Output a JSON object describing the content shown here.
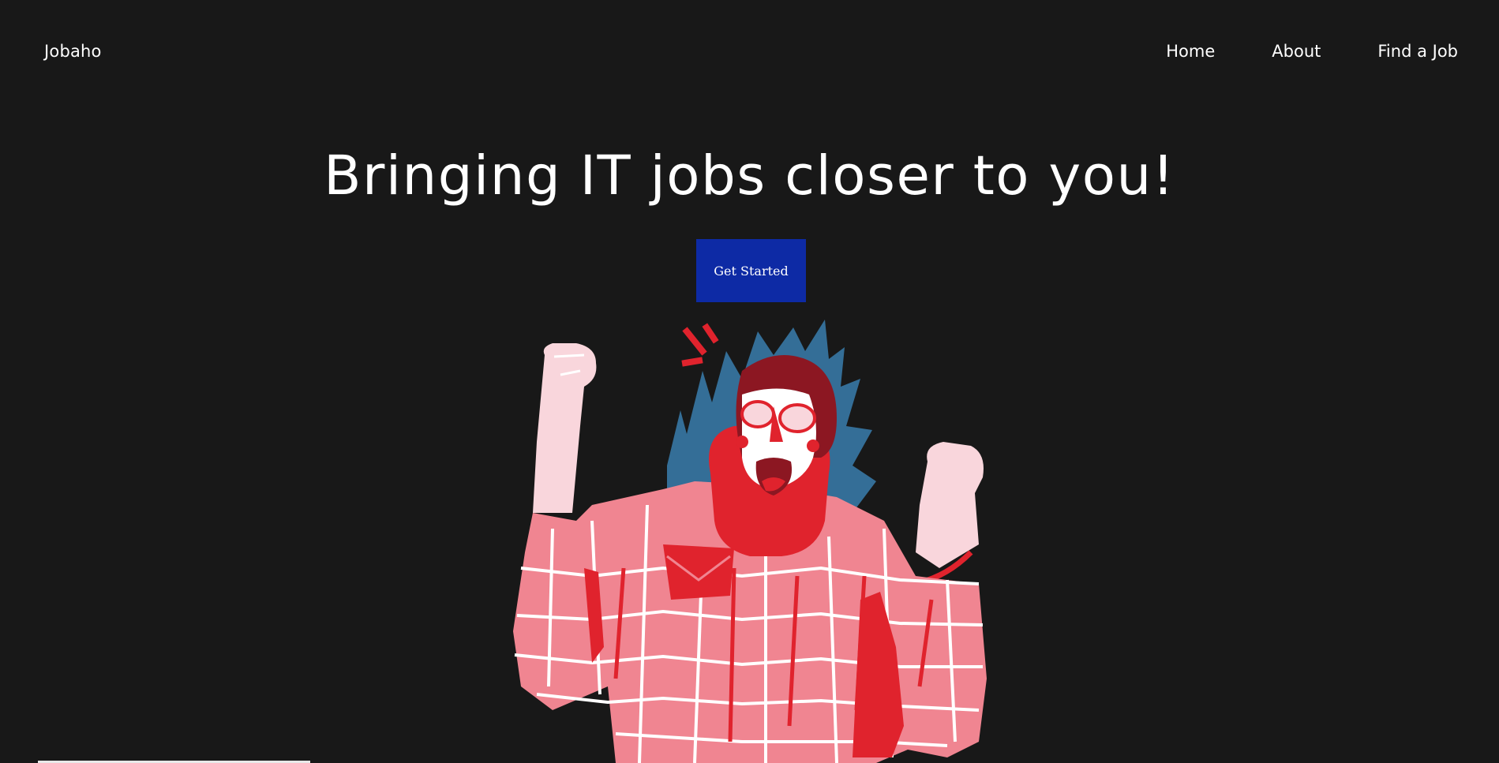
{
  "header": {
    "logo": "Jobaho",
    "nav": [
      "Home",
      "About",
      "Find a Job"
    ]
  },
  "hero": {
    "title": "Bringing IT jobs closer to you!",
    "cta_label": "Get Started"
  },
  "colors": {
    "background": "#181818",
    "cta": "#0d2aa5",
    "sweater": "#f08591",
    "red": "#e0232d",
    "hair_blue": "#346e97",
    "hat": "#8c1722",
    "skin_light": "#f9d6dc"
  }
}
